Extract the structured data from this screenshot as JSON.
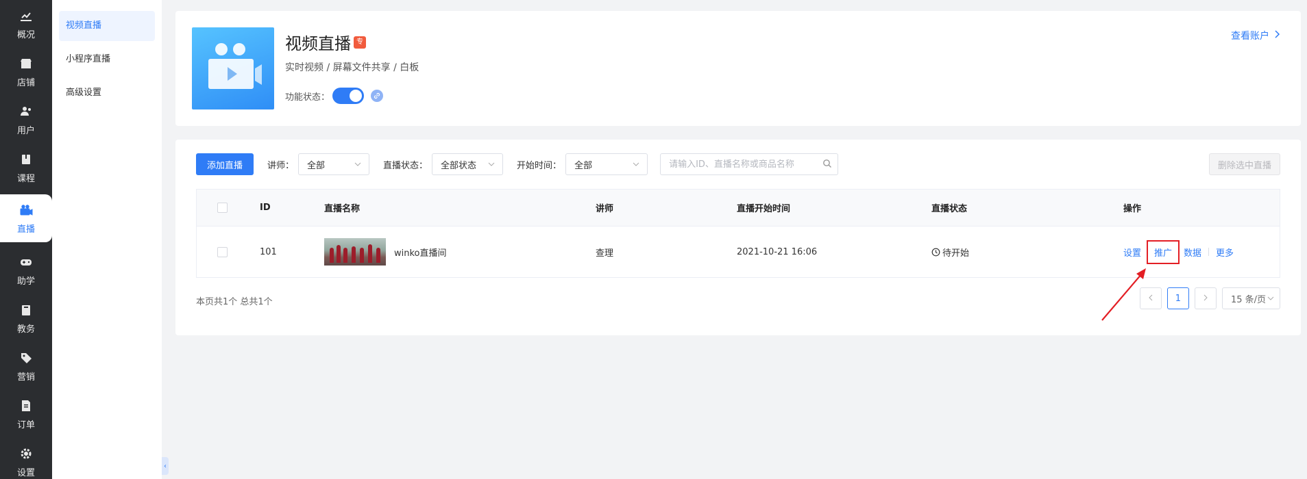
{
  "nav": {
    "items": [
      {
        "label": "概况",
        "icon": "chart-trend-icon"
      },
      {
        "label": "店铺",
        "icon": "store-icon"
      },
      {
        "label": "用户",
        "icon": "users-icon"
      },
      {
        "label": "课程",
        "icon": "book-icon"
      },
      {
        "label": "直播",
        "icon": "live-camera-icon",
        "active": true
      },
      {
        "label": "助学",
        "icon": "gamepad-icon"
      },
      {
        "label": "教务",
        "icon": "clipboard-icon"
      },
      {
        "label": "营销",
        "icon": "tag-icon"
      },
      {
        "label": "订单",
        "icon": "order-doc-icon"
      },
      {
        "label": "设置",
        "icon": "gear-icon"
      }
    ]
  },
  "subnav": {
    "items": [
      {
        "label": "视频直播",
        "active": true
      },
      {
        "label": "小程序直播"
      },
      {
        "label": "高级设置"
      }
    ]
  },
  "header": {
    "title": "视频直播",
    "badge": "专",
    "subtitle": "实时视频 / 屏幕文件共享 / 白板",
    "status_label": "功能状态：",
    "account_link": "查看账户"
  },
  "toolbar": {
    "add_button": "添加直播",
    "teacher_label": "讲师：",
    "teacher_value": "全部",
    "status_label": "直播状态：",
    "status_value": "全部状态",
    "time_label": "开始时间：",
    "time_value": "全部",
    "search_placeholder": "请输入ID、直播名称或商品名称",
    "delete_button": "删除选中直播"
  },
  "table": {
    "columns": [
      "ID",
      "直播名称",
      "讲师",
      "直播开始时间",
      "直播状态",
      "操作"
    ],
    "rows": [
      {
        "id": "101",
        "name": "winko直播间",
        "teacher": "查理",
        "start_time": "2021-10-21 16:06",
        "status": "待开始",
        "ops": [
          "设置",
          "推广",
          "数据",
          "更多"
        ]
      }
    ]
  },
  "footer": {
    "summary": "本页共1个 总共1个",
    "current_page": "1",
    "page_size": "15 条/页"
  },
  "colors": {
    "accent": "#2f7cf6",
    "nav_bg": "#2b2d30",
    "highlight_red": "#e31e24"
  }
}
